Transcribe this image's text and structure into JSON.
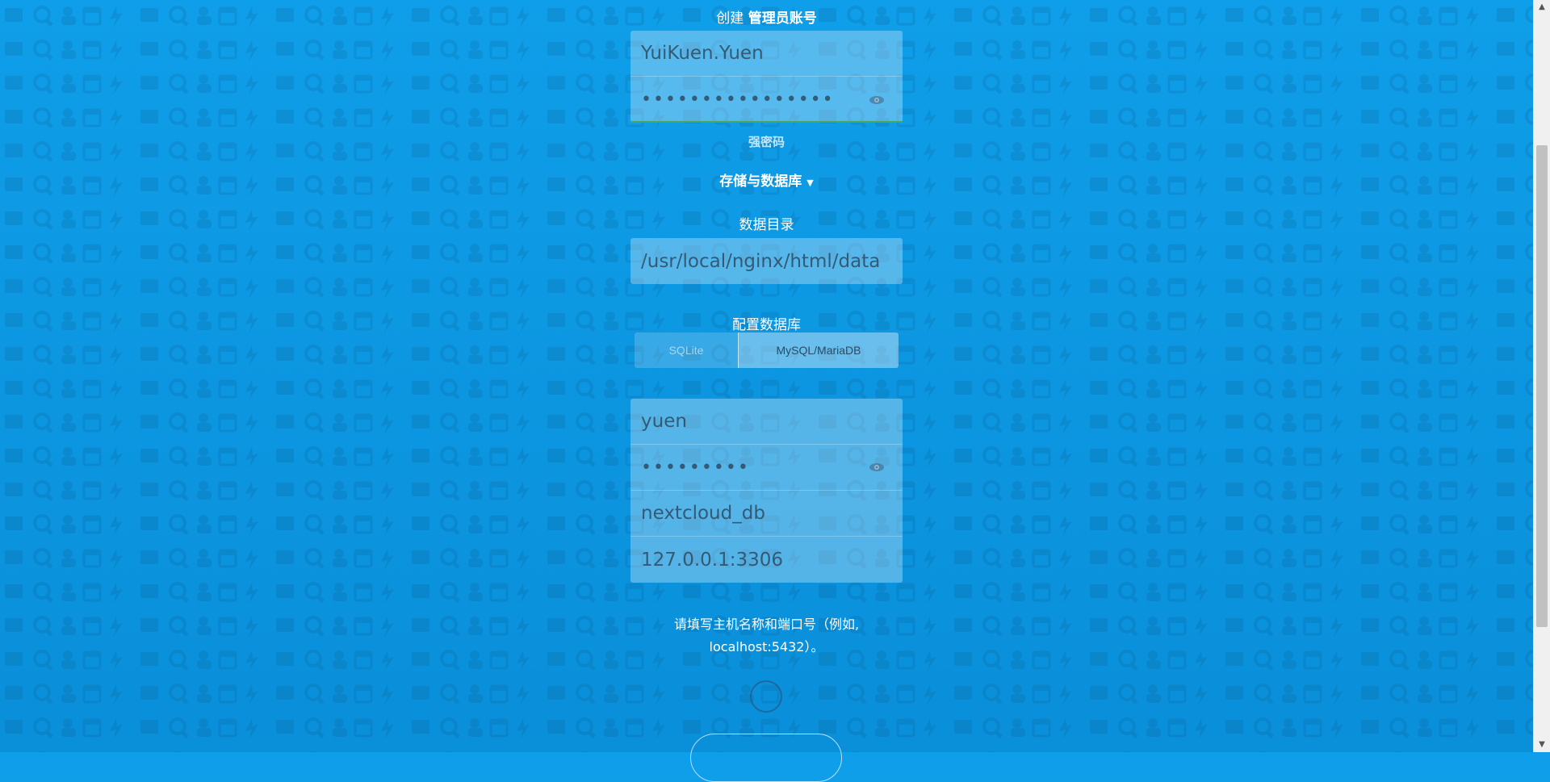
{
  "admin": {
    "heading_prefix": "创建",
    "heading_bold": "管理员账号",
    "username": "YuiKuen.Yuen",
    "password_mask": "••••••••••••••••",
    "strength_label": "强密码"
  },
  "storage": {
    "toggle_label": "存储与数据库",
    "data_dir_label": "数据目录",
    "data_dir_value": "/usr/local/nginx/html/data"
  },
  "database": {
    "label": "配置数据库",
    "options": [
      "SQLite",
      "MySQL/MariaDB"
    ],
    "selected": "MySQL/MariaDB",
    "user": "yuen",
    "password_mask": "•••••••••",
    "name": "nextcloud_db",
    "host": "127.0.0.1:3306"
  },
  "hint": {
    "line1": "请填写主机名称和端口号（例如,",
    "line2": "localhost:5432）。"
  },
  "colors": {
    "background": "#0f9ee9",
    "strength_bar": "#4aa757"
  }
}
